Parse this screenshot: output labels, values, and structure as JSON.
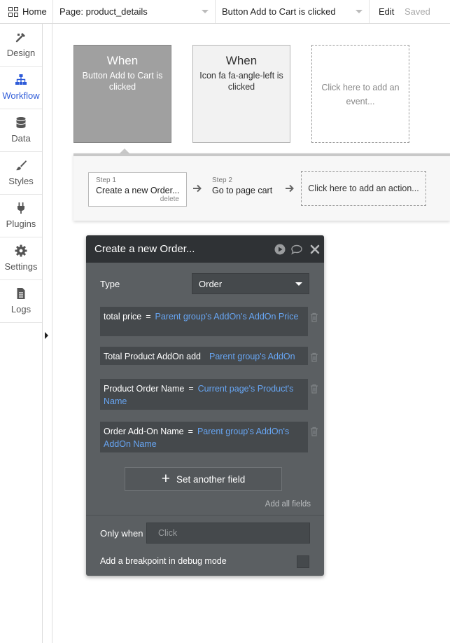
{
  "topbar": {
    "home_label": "Home",
    "page_selector": "Page: product_details",
    "event_selector": "Button Add to Cart is clicked",
    "edit_label": "Edit",
    "saved_label": "Saved"
  },
  "sidebar": {
    "items": [
      {
        "label": "Design",
        "icon": "design-icon",
        "active": false
      },
      {
        "label": "Workflow",
        "icon": "workflow-icon",
        "active": true
      },
      {
        "label": "Data",
        "icon": "database-icon",
        "active": false
      },
      {
        "label": "Styles",
        "icon": "brush-icon",
        "active": false
      },
      {
        "label": "Plugins",
        "icon": "plug-icon",
        "active": false
      },
      {
        "label": "Settings",
        "icon": "gear-icon",
        "active": false
      },
      {
        "label": "Logs",
        "icon": "document-icon",
        "active": false
      }
    ]
  },
  "events": [
    {
      "when": "When",
      "text": "Button Add to Cart is clicked",
      "selected": true
    },
    {
      "when": "When",
      "text": "Icon fa fa-angle-left is clicked",
      "selected": false
    },
    {
      "when": "",
      "text": "Click here to add an event...",
      "placeholder": true
    }
  ],
  "actions": {
    "steps": [
      {
        "number": "Step 1",
        "title": "Create a new Order...",
        "delete_label": "delete"
      },
      {
        "number": "Step 2",
        "title": "Go to page cart"
      }
    ],
    "add_action": "Click here to add an action..."
  },
  "panel": {
    "title": "Create a new Order...",
    "type_label": "Type",
    "type_value": "Order",
    "fields": [
      {
        "name": "total price",
        "eq": "=",
        "value": "Parent group's AddOn's AddOn Price"
      },
      {
        "name": "Total Product AddOn add",
        "eq": "",
        "value": "Parent group's AddOn"
      },
      {
        "name": "Product Order Name",
        "eq": "=",
        "value": "Current page's Product's Name"
      },
      {
        "name": "Order Add-On Name",
        "eq": "=",
        "value": "Parent group's AddOn's AddOn Name"
      }
    ],
    "set_field_label": "Set another field",
    "add_all_fields": "Add all fields",
    "only_when_label": "Only when",
    "only_when_placeholder": "Click",
    "breakpoint_label": "Add a breakpoint in debug mode"
  },
  "colors": {
    "accent": "#2e5bd8",
    "panel_bg": "#5b5f62",
    "panel_header": "#2f3235",
    "expression": "#67a5f2"
  }
}
